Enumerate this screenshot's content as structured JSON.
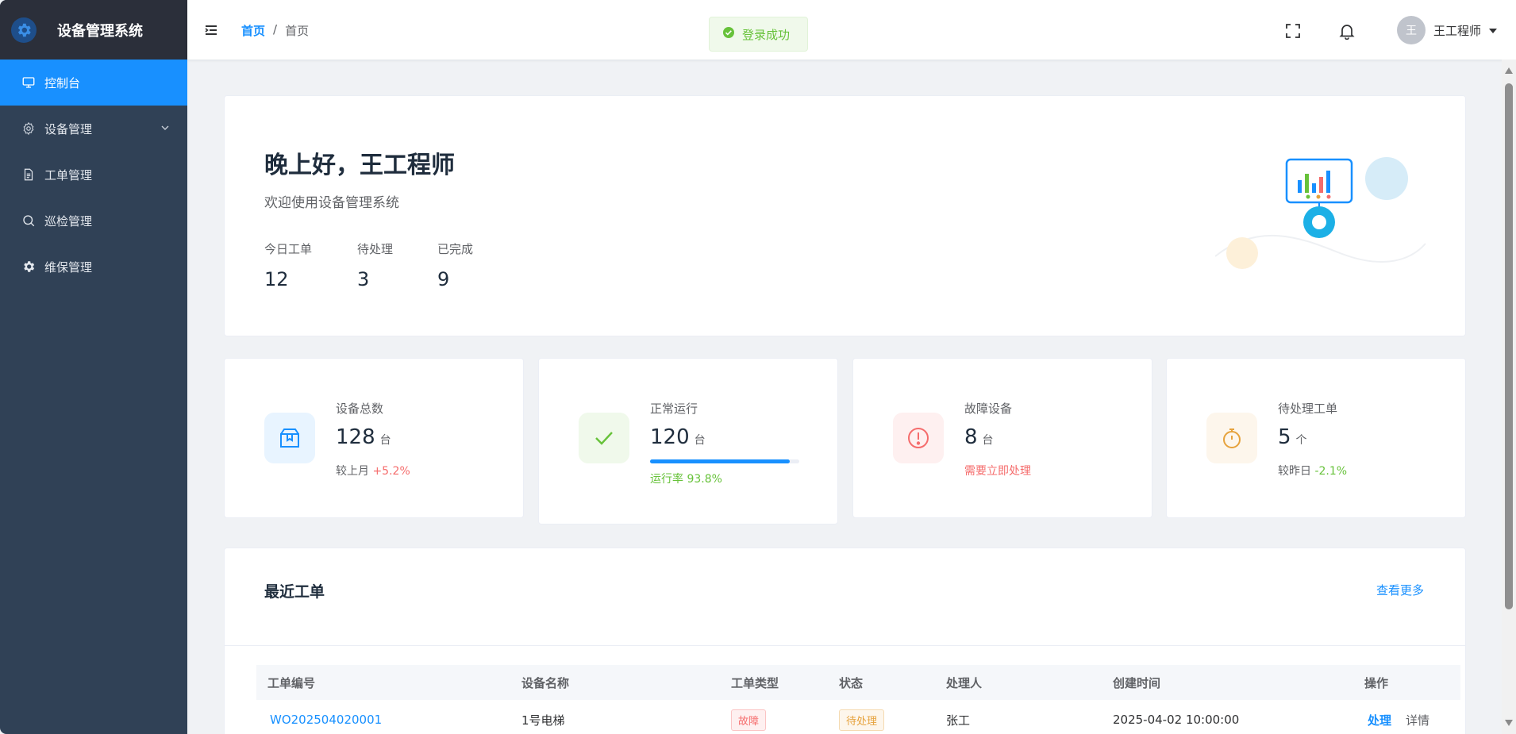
{
  "app": {
    "title": "设备管理系统"
  },
  "sidebar": {
    "items": [
      {
        "label": "控制台",
        "icon": "monitor-icon",
        "active": true
      },
      {
        "label": "设备管理",
        "icon": "gear-outline-icon",
        "has_children": true
      },
      {
        "label": "工单管理",
        "icon": "document-icon"
      },
      {
        "label": "巡检管理",
        "icon": "search-icon"
      },
      {
        "label": "维保管理",
        "icon": "gear-solid-icon"
      }
    ]
  },
  "header": {
    "breadcrumb": [
      "首页",
      "首页"
    ],
    "breadcrumb_sep": "/",
    "toast": "登录成功",
    "user": {
      "avatar_text": "王",
      "name": "王工程师"
    }
  },
  "welcome": {
    "greeting": "晚上好，王工程师",
    "subtitle": "欢迎使用设备管理系统",
    "stats": [
      {
        "label": "今日工单",
        "value": "12"
      },
      {
        "label": "待处理",
        "value": "3"
      },
      {
        "label": "已完成",
        "value": "9"
      }
    ]
  },
  "kpis": [
    {
      "label": "设备总数",
      "value": "128",
      "unit": "台",
      "sub_prefix": "较上月",
      "sub_value": "+5.2%",
      "icon": "box-icon",
      "color": "#1890ff",
      "bg": "#e8f4ff"
    },
    {
      "label": "正常运行",
      "value": "120",
      "unit": "台",
      "sub_prefix": "运行率",
      "sub_value": "93.8%",
      "progress": 0.938,
      "icon": "check-icon",
      "color": "#67c23a",
      "bg": "#f0f9eb"
    },
    {
      "label": "故障设备",
      "value": "8",
      "unit": "台",
      "sub_prefix": "需要立即处理",
      "icon": "alert-icon",
      "color": "#f56c6c",
      "bg": "#fef0f0"
    },
    {
      "label": "待处理工单",
      "value": "5",
      "unit": "个",
      "sub_prefix": "较昨日",
      "sub_value": "-2.1%",
      "icon": "stopwatch-icon",
      "color": "#e6a23c",
      "bg": "#fdf6ec"
    }
  ],
  "orders": {
    "title": "最近工单",
    "view_more": "查看更多",
    "columns": [
      "工单编号",
      "设备名称",
      "工单类型",
      "状态",
      "处理人",
      "创建时间",
      "操作"
    ],
    "rows": [
      {
        "id": "WO202504020001",
        "device": "1号电梯",
        "type": "故障",
        "status": "待处理",
        "assignee": "张工",
        "created": "2025-04-02 10:00:00",
        "action1": "处理",
        "action2": "详情"
      }
    ]
  }
}
